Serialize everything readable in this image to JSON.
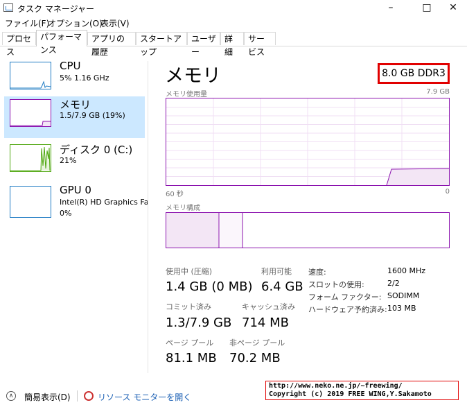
{
  "window": {
    "title": "タスク マネージャー"
  },
  "menu": [
    "ファイル(F)",
    "オプション(O)",
    "表示(V)"
  ],
  "tabs": [
    "プロセス",
    "パフォーマンス",
    "アプリの履歴",
    "スタートアップ",
    "ユーザー",
    "詳細",
    "サービス"
  ],
  "active_tab": "パフォーマンス",
  "sidebar": {
    "items": [
      {
        "name": "CPU",
        "sub": "5%  1.16 GHz",
        "color": "#1a78c2"
      },
      {
        "name": "メモリ",
        "sub": "1.5/7.9 GB (19%)",
        "color": "#8b12ae",
        "selected": true
      },
      {
        "name": "ディスク 0 (C:)",
        "sub": "21%",
        "color": "#4da60c"
      },
      {
        "name": "GPU 0",
        "sub1": "Intel(R) HD Graphics Far",
        "sub2": "0%",
        "color": "#1a78c2"
      }
    ]
  },
  "main": {
    "title": "メモリ",
    "memory_type": "8.0 GB DDR3",
    "usage_label": "メモリ使用量",
    "usage_max": "7.9 GB",
    "time_left": "60 秒",
    "time_right": "0",
    "composition_label": "メモリ構成",
    "stats": {
      "in_use_label": "使用中 (圧縮)",
      "in_use": "1.4 GB (0 MB)",
      "available_label": "利用可能",
      "available": "6.4 GB",
      "committed_label": "コミット済み",
      "committed": "1.3/7.9 GB",
      "cached_label": "キャッシュ済み",
      "cached": "714 MB",
      "paged_label": "ページ プール",
      "paged": "81.1 MB",
      "nonpaged_label": "非ページ プール",
      "nonpaged": "70.2 MB"
    },
    "details": [
      {
        "label": "速度:",
        "value": "1600 MHz"
      },
      {
        "label": "スロットの使用:",
        "value": "2/2"
      },
      {
        "label": "フォーム ファクター:",
        "value": "SODIMM"
      },
      {
        "label": "ハードウェア予約済み:",
        "value": "103 MB"
      }
    ]
  },
  "footer": {
    "fewer_details": "簡易表示(D)",
    "resource_monitor": "リソース モニターを開く",
    "copyright_line1": "http://www.neko.ne.jp/~freewing/",
    "copyright_line2": "Copyright (c) 2019 FREE WING,Y.Sakamoto"
  },
  "colors": {
    "memory": "#8b12ae",
    "cpu": "#1a78c2",
    "disk": "#4da60c",
    "highlight": "#cce8ff",
    "badge_border": "#e10000"
  },
  "icons": {
    "minimize": "minimize-icon",
    "maximize": "maximize-icon",
    "close": "close-icon",
    "chevron": "chevron-up-icon",
    "resmon": "resource-monitor-icon"
  }
}
